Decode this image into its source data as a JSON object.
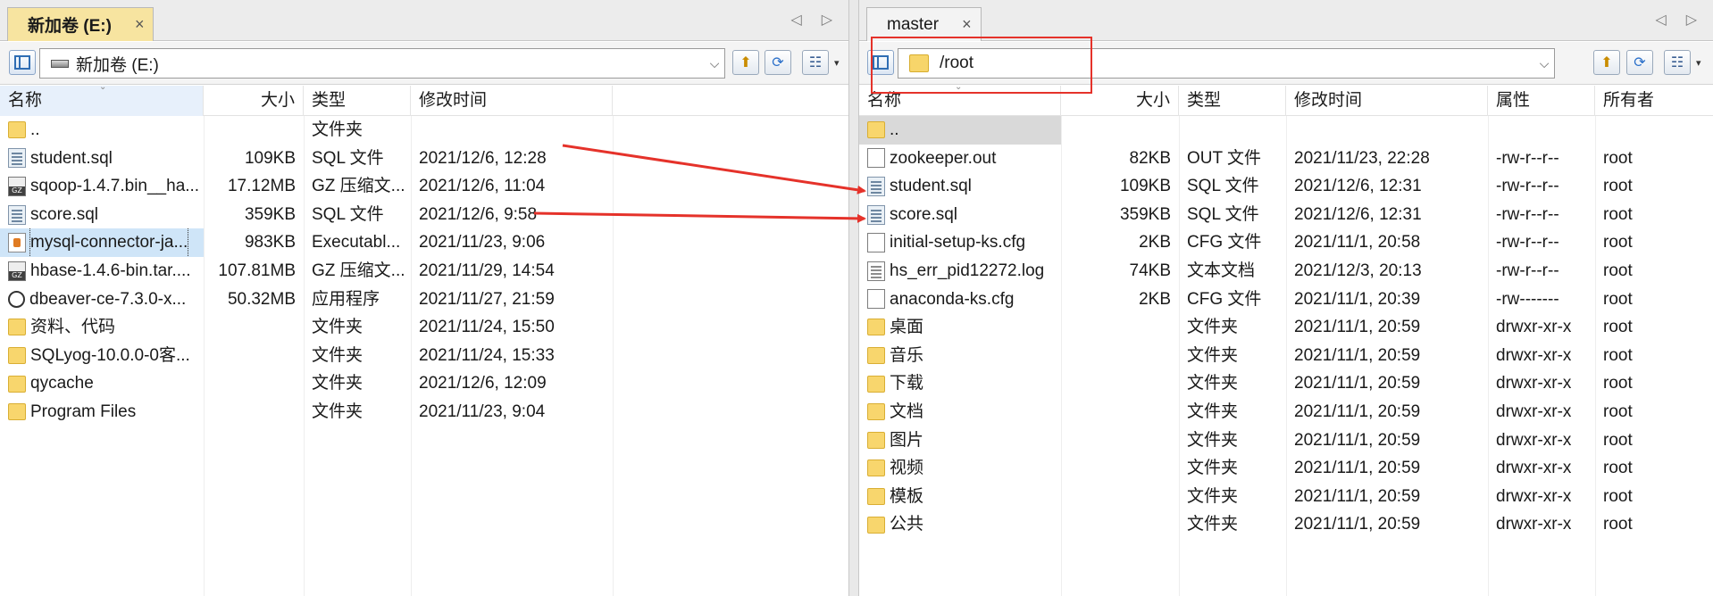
{
  "left_pane": {
    "tab": {
      "label": "新加卷 (E:)",
      "close": "×"
    },
    "path": "新加卷 (E:)",
    "columns": {
      "name": "名称",
      "size": "大小",
      "type": "类型",
      "modified": "修改时间"
    },
    "rows": [
      {
        "icon": "folder-icon",
        "name": "..",
        "size": "",
        "type": "文件夹",
        "modified": ""
      },
      {
        "icon": "sql-file-icon",
        "name": "student.sql",
        "size": "109KB",
        "type": "SQL 文件",
        "modified": "2021/12/6, 12:28"
      },
      {
        "icon": "gz-archive-icon",
        "name": "sqoop-1.4.7.bin__ha...",
        "size": "17.12MB",
        "type": "GZ 压缩文...",
        "modified": "2021/12/6, 11:04"
      },
      {
        "icon": "sql-file-icon",
        "name": "score.sql",
        "size": "359KB",
        "type": "SQL 文件",
        "modified": "2021/12/6, 9:58"
      },
      {
        "icon": "jar-file-icon",
        "name": "mysql-connector-ja...",
        "size": "983KB",
        "type": "Executabl...",
        "modified": "2021/11/23, 9:06"
      },
      {
        "icon": "gz-archive-icon",
        "name": "hbase-1.4.6-bin.tar....",
        "size": "107.81MB",
        "type": "GZ 压缩文...",
        "modified": "2021/11/29, 14:54"
      },
      {
        "icon": "app-icon",
        "name": "dbeaver-ce-7.3.0-x...",
        "size": "50.32MB",
        "type": "应用程序",
        "modified": "2021/11/27, 21:59"
      },
      {
        "icon": "folder-icon",
        "name": "资料、代码",
        "size": "",
        "type": "文件夹",
        "modified": "2021/11/24, 15:50"
      },
      {
        "icon": "folder-icon",
        "name": "SQLyog-10.0.0-0客...",
        "size": "",
        "type": "文件夹",
        "modified": "2021/11/24, 15:33"
      },
      {
        "icon": "folder-icon",
        "name": "qycache",
        "size": "",
        "type": "文件夹",
        "modified": "2021/12/6, 12:09"
      },
      {
        "icon": "folder-icon",
        "name": "Program Files",
        "size": "",
        "type": "文件夹",
        "modified": "2021/11/23, 9:04"
      }
    ]
  },
  "right_pane": {
    "tab": {
      "label": "master",
      "close": "×"
    },
    "path": "/root",
    "columns": {
      "name": "名称",
      "size": "大小",
      "type": "类型",
      "modified": "修改时间",
      "attrs": "属性",
      "owner": "所有者"
    },
    "rows": [
      {
        "icon": "folder-icon",
        "name": "..",
        "size": "",
        "type": "",
        "modified": "",
        "attrs": "",
        "owner": ""
      },
      {
        "icon": "file-icon",
        "name": "zookeeper.out",
        "size": "82KB",
        "type": "OUT 文件",
        "modified": "2021/11/23, 22:28",
        "attrs": "-rw-r--r--",
        "owner": "root"
      },
      {
        "icon": "sql-file-icon",
        "name": "student.sql",
        "size": "109KB",
        "type": "SQL 文件",
        "modified": "2021/12/6, 12:31",
        "attrs": "-rw-r--r--",
        "owner": "root"
      },
      {
        "icon": "sql-file-icon",
        "name": "score.sql",
        "size": "359KB",
        "type": "SQL 文件",
        "modified": "2021/12/6, 12:31",
        "attrs": "-rw-r--r--",
        "owner": "root"
      },
      {
        "icon": "file-icon",
        "name": "initial-setup-ks.cfg",
        "size": "2KB",
        "type": "CFG 文件",
        "modified": "2021/11/1, 20:58",
        "attrs": "-rw-r--r--",
        "owner": "root"
      },
      {
        "icon": "text-file-icon",
        "name": "hs_err_pid12272.log",
        "size": "74KB",
        "type": "文本文档",
        "modified": "2021/12/3, 20:13",
        "attrs": "-rw-r--r--",
        "owner": "root"
      },
      {
        "icon": "file-icon",
        "name": "anaconda-ks.cfg",
        "size": "2KB",
        "type": "CFG 文件",
        "modified": "2021/11/1, 20:39",
        "attrs": "-rw-------",
        "owner": "root"
      },
      {
        "icon": "folder-icon",
        "name": "桌面",
        "size": "",
        "type": "文件夹",
        "modified": "2021/11/1, 20:59",
        "attrs": "drwxr-xr-x",
        "owner": "root"
      },
      {
        "icon": "folder-icon",
        "name": "音乐",
        "size": "",
        "type": "文件夹",
        "modified": "2021/11/1, 20:59",
        "attrs": "drwxr-xr-x",
        "owner": "root"
      },
      {
        "icon": "folder-icon",
        "name": "下载",
        "size": "",
        "type": "文件夹",
        "modified": "2021/11/1, 20:59",
        "attrs": "drwxr-xr-x",
        "owner": "root"
      },
      {
        "icon": "folder-icon",
        "name": "文档",
        "size": "",
        "type": "文件夹",
        "modified": "2021/11/1, 20:59",
        "attrs": "drwxr-xr-x",
        "owner": "root"
      },
      {
        "icon": "folder-icon",
        "name": "图片",
        "size": "",
        "type": "文件夹",
        "modified": "2021/11/1, 20:59",
        "attrs": "drwxr-xr-x",
        "owner": "root"
      },
      {
        "icon": "folder-icon",
        "name": "视频",
        "size": "",
        "type": "文件夹",
        "modified": "2021/11/1, 20:59",
        "attrs": "drwxr-xr-x",
        "owner": "root"
      },
      {
        "icon": "folder-icon",
        "name": "模板",
        "size": "",
        "type": "文件夹",
        "modified": "2021/11/1, 20:59",
        "attrs": "drwxr-xr-x",
        "owner": "root"
      },
      {
        "icon": "folder-icon",
        "name": "公共",
        "size": "",
        "type": "文件夹",
        "modified": "2021/11/1, 20:59",
        "attrs": "drwxr-xr-x",
        "owner": "root"
      }
    ]
  },
  "colors": {
    "annotation_red": "#e5322a",
    "active_tab": "#f7e4a0",
    "selection": "#cfe5f8"
  },
  "icons": {
    "nav_prev": "◁",
    "nav_next": "▷",
    "dropdown": "⌵",
    "up_folder": "⬆",
    "refresh": "⟳",
    "view": "☷",
    "view_caret": "▾",
    "sort_caret": "⌄"
  }
}
